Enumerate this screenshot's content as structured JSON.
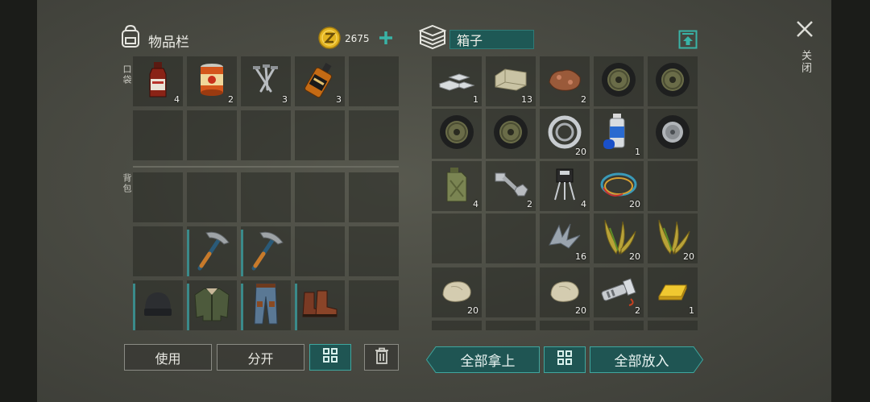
{
  "inventory": {
    "title": "物品栏",
    "currency": "2675",
    "pocket_label": "口袋",
    "backpack_label": "背包",
    "pocket_items": [
      {
        "name": "hot-sauce-bottle",
        "qty": "4"
      },
      {
        "name": "canned-food",
        "qty": "2"
      },
      {
        "name": "nails",
        "qty": "3"
      },
      {
        "name": "whiskey-bottle",
        "qty": "3"
      }
    ],
    "backpack_tools": [
      {
        "name": "pickaxe"
      },
      {
        "name": "pickaxe"
      }
    ],
    "equipment": [
      {
        "name": "beanie-hat"
      },
      {
        "name": "bomber-jacket"
      },
      {
        "name": "jeans"
      },
      {
        "name": "leather-boots"
      }
    ],
    "buttons": {
      "use": "使用",
      "split": "分开"
    }
  },
  "chest": {
    "title": "箱子",
    "items": [
      {
        "name": "iron-bars",
        "qty": "1"
      },
      {
        "name": "limestone",
        "qty": "13"
      },
      {
        "name": "copper-ore",
        "qty": "2"
      },
      {
        "name": "tire",
        "qty": ""
      },
      {
        "name": "tire",
        "qty": ""
      },
      {
        "name": "tire",
        "qty": ""
      },
      {
        "name": "tire",
        "qty": ""
      },
      {
        "name": "bearing",
        "qty": "20"
      },
      {
        "name": "spray-paint",
        "qty": "1"
      },
      {
        "name": "wheel",
        "qty": ""
      },
      {
        "name": "jerrycan",
        "qty": "4"
      },
      {
        "name": "bolt-and-nut",
        "qty": "2"
      },
      {
        "name": "transistor",
        "qty": "4"
      },
      {
        "name": "wires",
        "qty": "20"
      },
      {
        "name": "empty",
        "qty": ""
      },
      {
        "name": "empty",
        "qty": ""
      },
      {
        "name": "empty",
        "qty": ""
      },
      {
        "name": "scrap-metal",
        "qty": "16"
      },
      {
        "name": "plant-fiber",
        "qty": "20"
      },
      {
        "name": "plant-fiber",
        "qty": "20"
      },
      {
        "name": "stone",
        "qty": "20"
      },
      {
        "name": "empty",
        "qty": ""
      },
      {
        "name": "stone",
        "qty": "20"
      },
      {
        "name": "flashlight",
        "qty": "2"
      },
      {
        "name": "gold-bar",
        "qty": "1"
      }
    ],
    "buttons": {
      "take_all": "全部拿上",
      "put_all": "全部放入"
    }
  },
  "close_label": "关闭",
  "colors": {
    "teal": "#1f5553",
    "teal_border": "#3fa69e",
    "coin": "#e2b31f",
    "background": "#4a4b43"
  }
}
